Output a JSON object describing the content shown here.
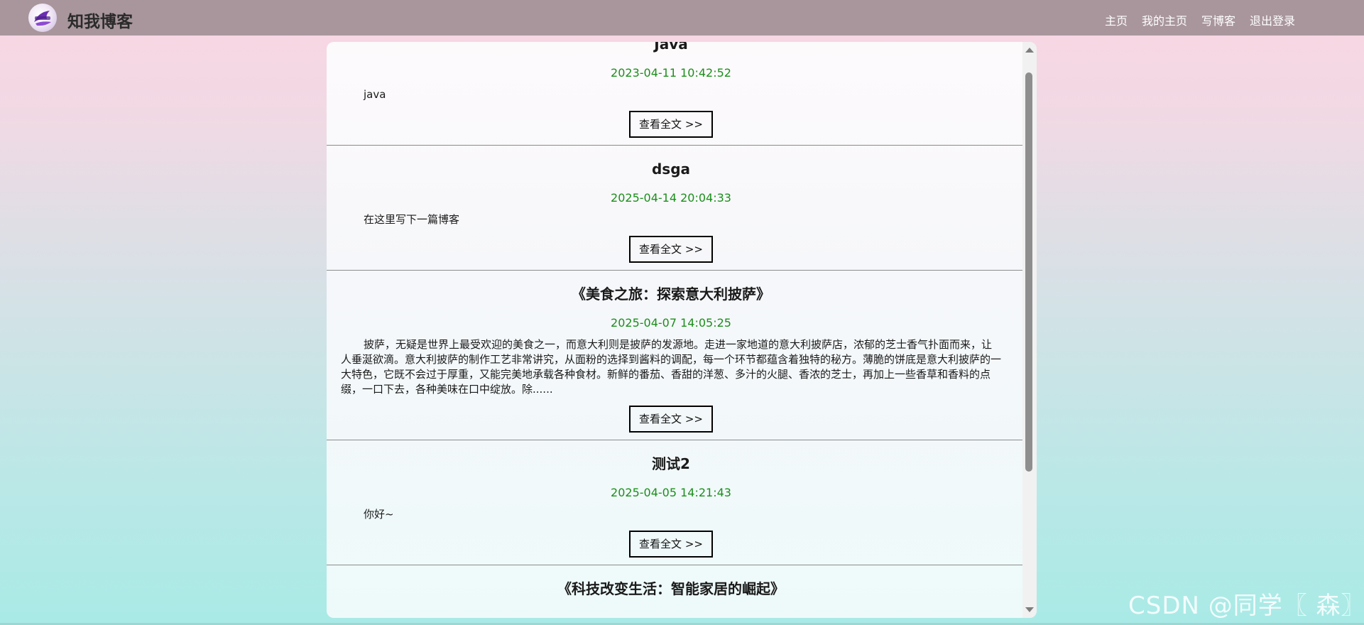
{
  "brand": {
    "name": "知我博客",
    "logo_icon": "blog-logo-icon"
  },
  "nav": {
    "items": [
      {
        "label": "主页"
      },
      {
        "label": "我的主页"
      },
      {
        "label": "写博客"
      },
      {
        "label": "退出登录"
      }
    ]
  },
  "blogs": [
    {
      "title": "Java",
      "date": "2023-04-11 10:42:52",
      "desc": "java",
      "button": "查看全文 >>"
    },
    {
      "title": "dsga",
      "date": "2025-04-14 20:04:33",
      "desc": "在这里写下一篇博客",
      "button": "查看全文 >>"
    },
    {
      "title": "《美食之旅：探索意大利披萨》",
      "date": "2025-04-07 14:05:25",
      "desc": "披萨，无疑是世界上最受欢迎的美食之一，而意大利则是披萨的发源地。走进一家地道的意大利披萨店，浓郁的芝士香气扑面而来，让人垂涎欲滴。意大利披萨的制作工艺非常讲究，从面粉的选择到酱料的调配，每一个环节都蕴含着独特的秘方。薄脆的饼底是意大利披萨的一大特色，它既不会过于厚重，又能完美地承载各种食材。新鲜的番茄、香甜的洋葱、多汁的火腿、香浓的芝士，再加上一些香草和香料的点缀，一口下去，各种美味在口中绽放。除......",
      "button": "查看全文 >>"
    },
    {
      "title": "测试2",
      "date": "2025-04-05 14:21:43",
      "desc": "你好~",
      "button": "查看全文 >>"
    },
    {
      "title": "《科技改变生活：智能家居的崛起》",
      "date": "",
      "desc": "",
      "button": ""
    }
  ],
  "watermark": "CSDN @同学〖 森〗"
}
